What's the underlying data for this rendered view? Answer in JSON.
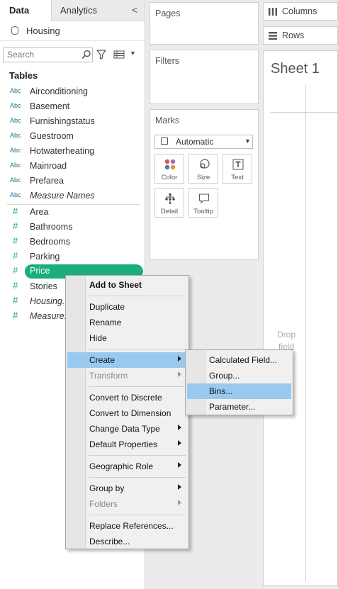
{
  "left_pane": {
    "tabs": [
      "Data",
      "Analytics"
    ],
    "collapse_glyph": "<",
    "datasource": "Housing",
    "search_placeholder": "Search",
    "tables_heading": "Tables",
    "dimension_badge": "Abc",
    "measure_badge": "#",
    "dimensions": [
      {
        "label": "Airconditioning",
        "italic": false
      },
      {
        "label": "Basement",
        "italic": false
      },
      {
        "label": "Furnishingstatus",
        "italic": false
      },
      {
        "label": "Guestroom",
        "italic": false
      },
      {
        "label": "Hotwaterheating",
        "italic": false
      },
      {
        "label": "Mainroad",
        "italic": false
      },
      {
        "label": "Prefarea",
        "italic": false
      },
      {
        "label": "Measure Names",
        "italic": true
      }
    ],
    "measures": [
      {
        "label": "Area",
        "italic": false
      },
      {
        "label": "Bathrooms",
        "italic": false
      },
      {
        "label": "Bedrooms",
        "italic": false
      },
      {
        "label": "Parking",
        "italic": false
      },
      {
        "label": "Price",
        "italic": false,
        "selected": true
      },
      {
        "label": "Stories",
        "italic": false
      },
      {
        "label": "Housing...",
        "italic": true
      },
      {
        "label": "Measure...",
        "italic": true
      }
    ]
  },
  "shelves": {
    "pages": "Pages",
    "filters": "Filters",
    "marks": "Marks",
    "mark_type": "Automatic",
    "mark_buttons": [
      "Color",
      "Size",
      "Text",
      "Detail",
      "Tooltip"
    ],
    "columns": "Columns",
    "rows": "Rows"
  },
  "view": {
    "sheet_title": "Sheet 1",
    "drop_field_lines": [
      "Drop",
      "field"
    ]
  },
  "context_menu": {
    "items": [
      {
        "label": "Add to Sheet",
        "bold": true
      },
      {
        "sep": true
      },
      {
        "label": "Duplicate"
      },
      {
        "label": "Rename"
      },
      {
        "label": "Hide"
      },
      {
        "sep": true
      },
      {
        "label": "Create",
        "submenu": true,
        "highlighted": true
      },
      {
        "label": "Transform",
        "submenu": true,
        "disabled": true
      },
      {
        "sep": true
      },
      {
        "label": "Convert to Discrete"
      },
      {
        "label": "Convert to Dimension"
      },
      {
        "label": "Change Data Type",
        "submenu": true
      },
      {
        "label": "Default Properties",
        "submenu": true
      },
      {
        "sep": true
      },
      {
        "label": "Geographic Role",
        "submenu": true
      },
      {
        "sep": true
      },
      {
        "label": "Group by",
        "submenu": true
      },
      {
        "label": "Folders",
        "submenu": true,
        "disabled": true
      },
      {
        "sep": true
      },
      {
        "label": "Replace References..."
      },
      {
        "label": "Describe..."
      }
    ]
  },
  "create_submenu": {
    "items": [
      {
        "label": "Calculated Field..."
      },
      {
        "label": "Group..."
      },
      {
        "label": "Bins...",
        "highlighted": true
      },
      {
        "label": "Parameter..."
      }
    ]
  },
  "colors": {
    "measure_green": "#1aae7c",
    "dimension_blue": "#1f6f8b",
    "menu_highlight": "#99c9ef"
  }
}
